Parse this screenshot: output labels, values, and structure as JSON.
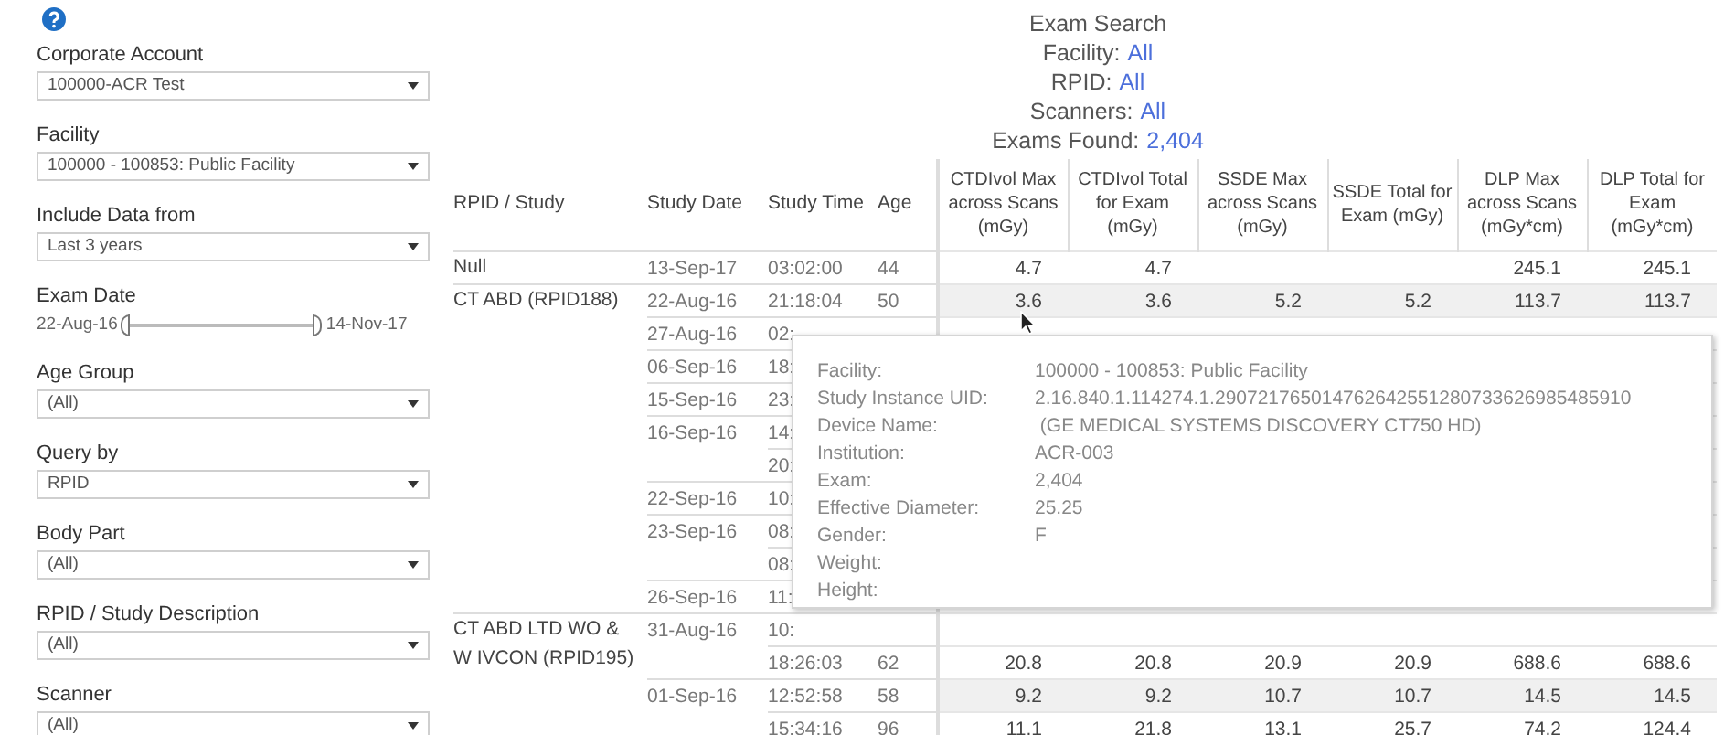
{
  "filters": [
    {
      "kind": "dropdown",
      "label": "Corporate Account",
      "value": "100000-ACR Test"
    },
    {
      "kind": "dropdown",
      "label": "Facility",
      "value": "100000 - 100853: Public Facility"
    },
    {
      "kind": "dropdown",
      "label": "Include Data from",
      "value": "Last 3 years"
    },
    {
      "kind": "range",
      "label": "Exam Date",
      "from": "22-Aug-16",
      "to": "14-Nov-17",
      "level": 1
    },
    {
      "kind": "dropdown",
      "label": "Age Group",
      "value": "(All)"
    },
    {
      "kind": "dropdown",
      "label": "Query by",
      "value": "RPID"
    },
    {
      "kind": "dropdown",
      "label": "Body Part",
      "value": "(All)"
    },
    {
      "kind": "dropdown",
      "label": "RPID / Study Description",
      "value": "(All)"
    },
    {
      "kind": "dropdown",
      "label": "Scanner",
      "value": "(All)"
    }
  ],
  "summary": {
    "title": "Exam Search",
    "lines": [
      {
        "label": "Facility:",
        "value": "All"
      },
      {
        "label": "RPID:",
        "value": "All"
      },
      {
        "label": "Scanners:",
        "value": "All"
      },
      {
        "label": "Exams Found:",
        "value": "2,404"
      }
    ]
  },
  "table": {
    "columns": [
      "RPID / Study",
      "Study Date",
      "Study Time",
      "Age",
      "CTDIvol Max across Scans (mGy)",
      "CTDIvol Total for Exam (mGy)",
      "SSDE Max across Scans (mGy)",
      "SSDE Total for Exam (mGy)",
      "DLP Max across Scans (mGy*cm)",
      "DLP Total for Exam (mGy*cm)"
    ],
    "groups": [
      {
        "rpid": "Null",
        "dates": [
          {
            "date": "13-Sep-17",
            "times": [
              {
                "time": "03:02:00",
                "age": "44",
                "values": {
                  "ctdivol_max": "4.7",
                  "ctdivol_total": "4.7",
                  "dlp_max": "245.1",
                  "dlp_total": "245.1"
                },
                "shaded": false
              }
            ]
          }
        ]
      },
      {
        "rpid": "CT ABD (RPID188)",
        "dates": [
          {
            "date": "22-Aug-16",
            "times": [
              {
                "time": "21:18:04",
                "age": "50",
                "values": {
                  "ctdivol_max": "3.6",
                  "ctdivol_total": "3.6",
                  "ssde_max": "5.2",
                  "ssde_total": "5.2",
                  "dlp_max": "113.7",
                  "dlp_total": "113.7"
                },
                "shaded": true
              }
            ]
          },
          {
            "date": "27-Aug-16",
            "times": [
              {
                "time": "02:"
              }
            ]
          },
          {
            "date": "06-Sep-16",
            "times": [
              {
                "time": "18:"
              }
            ]
          },
          {
            "date": "15-Sep-16",
            "times": [
              {
                "time": "23:"
              }
            ]
          },
          {
            "date": "16-Sep-16",
            "times": [
              {
                "time": "14:"
              },
              {
                "time": "20:"
              }
            ]
          },
          {
            "date": "22-Sep-16",
            "times": [
              {
                "time": "10:"
              }
            ]
          },
          {
            "date": "23-Sep-16",
            "times": [
              {
                "time": "08:"
              },
              {
                "time": "08:"
              }
            ]
          },
          {
            "date": "26-Sep-16",
            "times": [
              {
                "time": "11:"
              }
            ]
          }
        ]
      },
      {
        "rpid": "CT ABD LTD WO & W IVCON (RPID195)",
        "dates": [
          {
            "date": "31-Aug-16",
            "times": [
              {
                "time": "10:"
              },
              {
                "time": "18:26:03",
                "age": "62",
                "values": {
                  "ctdivol_max": "20.8",
                  "ctdivol_total": "20.8",
                  "ssde_max": "20.9",
                  "ssde_total": "20.9",
                  "dlp_max": "688.6",
                  "dlp_total": "688.6"
                },
                "shaded": false
              }
            ]
          },
          {
            "date": "01-Sep-16",
            "times": [
              {
                "time": "12:52:58",
                "age": "58",
                "values": {
                  "ctdivol_max": "9.2",
                  "ctdivol_total": "9.2",
                  "ssde_max": "10.7",
                  "ssde_total": "10.7",
                  "dlp_max": "14.5",
                  "dlp_total": "14.5"
                },
                "shaded": true
              },
              {
                "time": "15:34:16",
                "age": "96",
                "values": {
                  "ctdivol_max": "11.1",
                  "ctdivol_total": "21.8",
                  "ssde_max": "13.1",
                  "ssde_total": "25.7",
                  "dlp_max": "74.2",
                  "dlp_total": "124.4"
                },
                "shaded": false
              }
            ]
          }
        ]
      }
    ]
  },
  "tooltip": [
    {
      "label": "Facility:",
      "value": "100000 - 100853: Public Facility"
    },
    {
      "label": "Study Instance UID:",
      "value": "2.16.840.1.114274.1.290721765014762642551280733626985485910"
    },
    {
      "label": "Device Name:",
      "value": " (GE MEDICAL SYSTEMS DISCOVERY CT750 HD)"
    },
    {
      "label": "Institution:",
      "value": "ACR-003"
    },
    {
      "label": "Exam:",
      "value": "2,404"
    },
    {
      "label": "Effective Diameter:",
      "value": "25.25"
    },
    {
      "label": "Gender:",
      "value": "F"
    },
    {
      "label": "Weight:"
    },
    {
      "label": "Height:"
    }
  ]
}
